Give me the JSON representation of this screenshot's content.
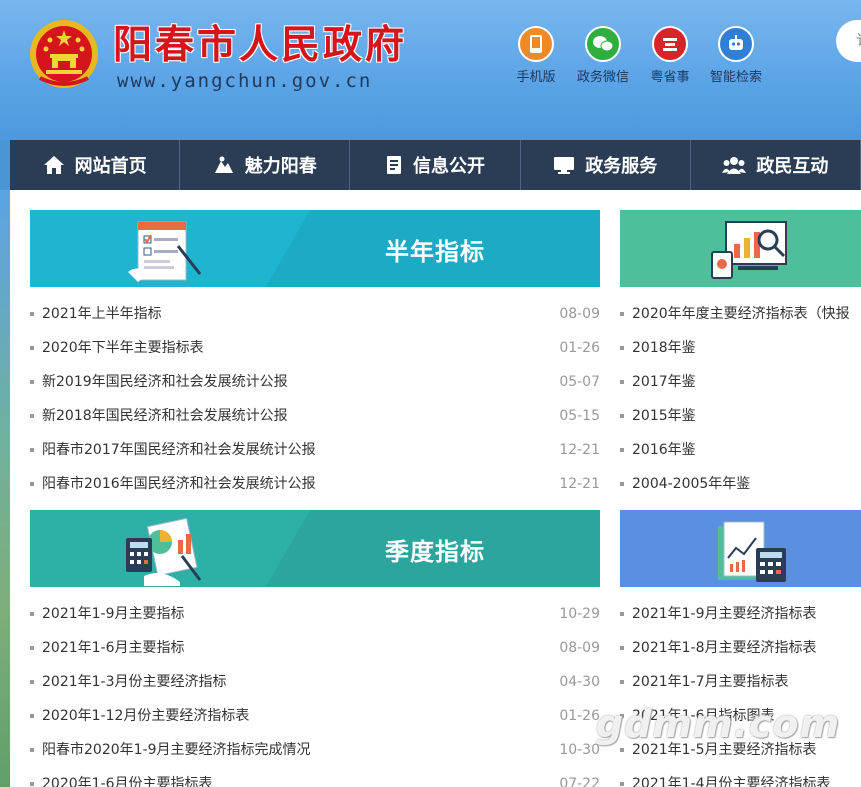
{
  "header": {
    "title": "阳春市人民政府",
    "url": "www.yangchun.gov.cn",
    "quick_links": [
      {
        "label": "手机版",
        "icon": "mobile-icon",
        "color": "#f08a24"
      },
      {
        "label": "政务微信",
        "icon": "wechat-icon",
        "color": "#2fae3f"
      },
      {
        "label": "粤省事",
        "icon": "yueshengshi-icon",
        "color": "#d9232a"
      },
      {
        "label": "智能检索",
        "icon": "robot-icon",
        "color": "#2f7fd6"
      }
    ],
    "search_stub": "讠"
  },
  "nav": [
    {
      "label": "网站首页",
      "icon": "home-icon"
    },
    {
      "label": "魅力阳春",
      "icon": "scenery-icon"
    },
    {
      "label": "信息公开",
      "icon": "document-icon"
    },
    {
      "label": "政务服务",
      "icon": "monitor-icon"
    },
    {
      "label": "政民互动",
      "icon": "people-icon"
    }
  ],
  "sections": {
    "half_year": {
      "title": "半年指标",
      "color": "#1fb5d0",
      "items": [
        {
          "text": "2021年上半年指标",
          "date": "08-09"
        },
        {
          "text": "2020年下半年主要指标表",
          "date": "01-26"
        },
        {
          "text": "新2019年国民经济和社会发展统计公报",
          "date": "05-07"
        },
        {
          "text": "新2018年国民经济和社会发展统计公报",
          "date": "05-15"
        },
        {
          "text": "阳春市2017年国民经济和社会发展统计公报",
          "date": "12-21"
        },
        {
          "text": "阳春市2016年国民经济和社会发展统计公报",
          "date": "12-21"
        }
      ]
    },
    "annual": {
      "color": "#4fbf9b",
      "items": [
        {
          "text": "2020年年度主要经济指标表（快报"
        },
        {
          "text": "2018年鉴"
        },
        {
          "text": "2017年鉴"
        },
        {
          "text": "2015年鉴"
        },
        {
          "text": "2016年鉴"
        },
        {
          "text": "2004-2005年年鉴"
        }
      ]
    },
    "quarterly": {
      "title": "季度指标",
      "color": "#2fb0a6",
      "items": [
        {
          "text": "2021年1-9月主要指标",
          "date": "10-29"
        },
        {
          "text": "2021年1-6月主要指标",
          "date": "08-09"
        },
        {
          "text": "2021年1-3月份主要经济指标",
          "date": "04-30"
        },
        {
          "text": "2020年1-12月份主要经济指标表",
          "date": "01-26"
        },
        {
          "text": "阳春市2020年1-9月主要经济指标完成情况",
          "date": "10-30"
        },
        {
          "text": "2020年1-6月份主要指标表",
          "date": "07-22"
        }
      ]
    },
    "monthly": {
      "color": "#5b8fe0",
      "items": [
        {
          "text": "2021年1-9月主要经济指标表"
        },
        {
          "text": "2021年1-8月主要经济指标表"
        },
        {
          "text": "2021年1-7月主要指标表"
        },
        {
          "text": "2021年1-6月指标图表"
        },
        {
          "text": "2021年1-5月主要经济指标表"
        },
        {
          "text": "2021年1-4月份主要经济指标表"
        }
      ]
    }
  },
  "watermark": "gdmm.com"
}
